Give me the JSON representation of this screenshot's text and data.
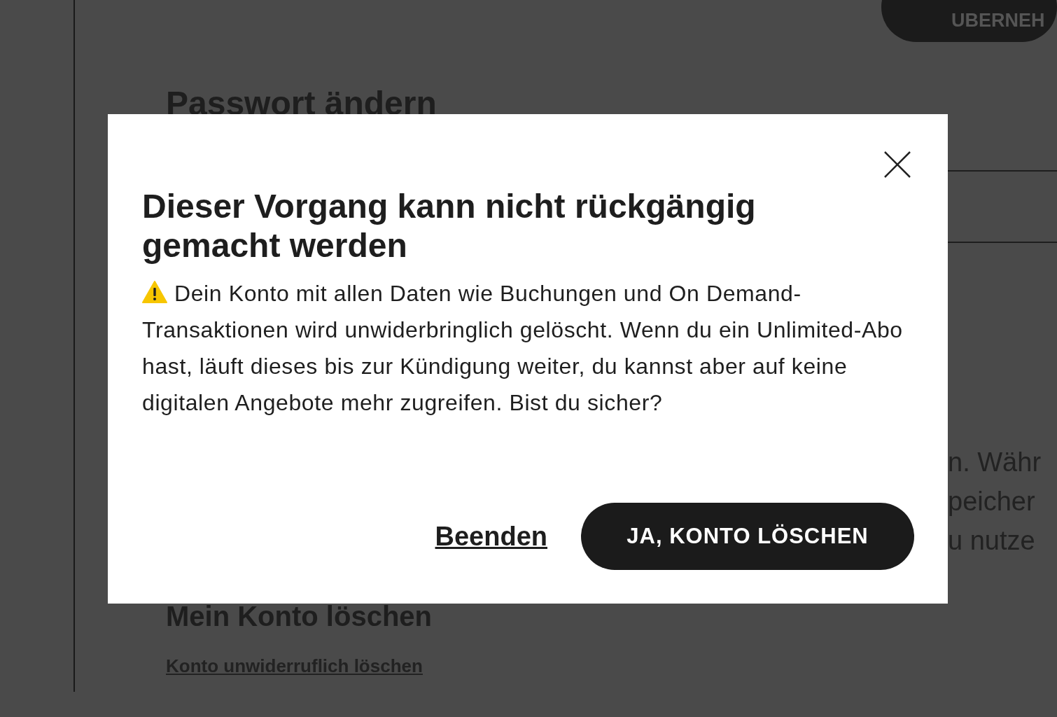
{
  "background": {
    "top_button": "UBERNEH",
    "heading": "Passwort ändern",
    "text_fragments": [
      "n. Währ",
      "peicher",
      "u nutze"
    ],
    "delete_heading": "Mein Konto löschen",
    "delete_link": "Konto unwiderruflich löschen"
  },
  "dialog": {
    "title": "Dieser Vorgang kann nicht rückgängig gemacht werden",
    "message": "Dein Konto mit allen Daten wie Buchungen und On Demand-Transaktionen wird unwiderbringlich gelöscht. Wenn du ein Unlimited-Abo hast, läuft dieses bis zur Kündigung weiter, du kannst aber auf keine digitalen Angebote mehr zugreifen. Bist du sicher?",
    "cancel": "Beenden",
    "confirm": "JA, KONTO LÖSCHEN"
  }
}
